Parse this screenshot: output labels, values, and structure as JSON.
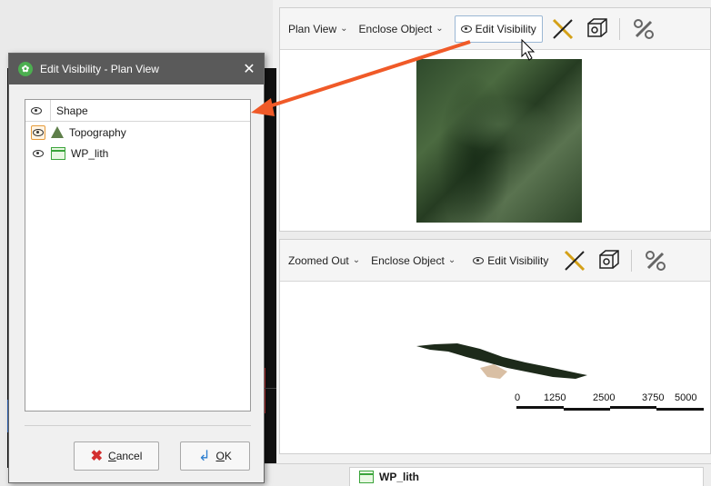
{
  "plan_view": {
    "view_menu": "Plan View",
    "enclose_menu": "Enclose Object",
    "edit_visibility": "Edit Visibility"
  },
  "zoomed_view": {
    "view_menu": "Zoomed Out",
    "enclose_menu": "Enclose Object",
    "edit_visibility": "Edit Visibility",
    "scale_labels": [
      "0",
      "1250",
      "2500",
      "3750",
      "5000"
    ]
  },
  "bottom_tab": {
    "label": "WP_lith"
  },
  "dialog": {
    "title": "Edit Visibility - Plan View",
    "close_glyph": "✕",
    "app_icon_glyph": "✿",
    "column_header": "Shape",
    "rows": [
      {
        "label": "Topography",
        "highlighted": true,
        "icon": "topography-icon"
      },
      {
        "label": "WP_lith",
        "highlighted": false,
        "icon": "table-icon"
      }
    ],
    "cancel_label": "Cancel",
    "ok_label": "OK"
  },
  "colors": {
    "annotation_arrow": "#f05a28",
    "dialog_titlebar": "#5a5a5a",
    "highlight_border": "#e69b3a"
  }
}
